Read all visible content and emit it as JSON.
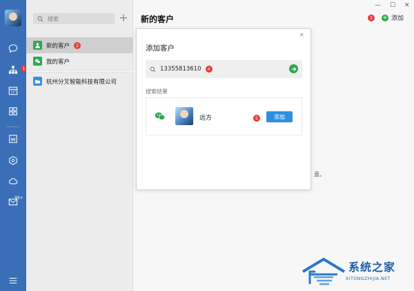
{
  "sidebar": {
    "contacts_badge": "1",
    "mail_badge": "99+"
  },
  "list": {
    "search_placeholder": "搜索",
    "add_symbol": "+",
    "items": [
      {
        "label": "新的客户",
        "badge": "2"
      },
      {
        "label": "我的客户"
      },
      {
        "label": "杭州分叉智能科技有限公司"
      }
    ]
  },
  "main": {
    "title": "新的客户",
    "add_badge": "3",
    "add_label": "添加",
    "window_controls": {
      "minimize": "—",
      "maximize": "☐",
      "close": "✕"
    },
    "background_fragment": "意。"
  },
  "modal": {
    "title": "添加客户",
    "close": "×",
    "search_value": "13355813610",
    "search_badge": "4",
    "results_label": "搜索结果",
    "result": {
      "name": "远方",
      "badge": "5",
      "add_label": "添加"
    }
  },
  "watermark": {
    "text": "系统之家",
    "sub": "XITONGZHIJIA.NET"
  },
  "colors": {
    "rail": "#3a6fb8",
    "accent_blue": "#2c8fe4",
    "accent_green": "#2fa84f",
    "badge_red": "#e63b3b"
  }
}
